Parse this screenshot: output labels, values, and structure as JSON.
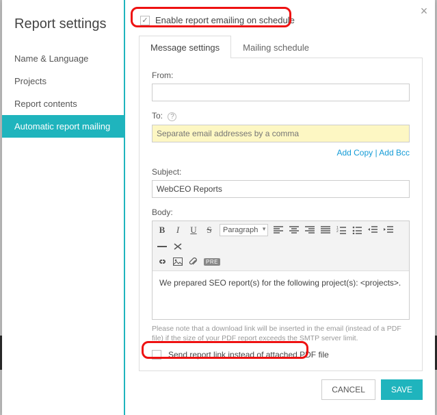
{
  "modal": {
    "title": "Report settings",
    "nav": [
      {
        "label": "Name & Language"
      },
      {
        "label": "Projects"
      },
      {
        "label": "Report contents"
      },
      {
        "label": "Automatic report mailing"
      }
    ],
    "enable": {
      "label": "Enable report emailing on schedule",
      "checked": true
    },
    "tabs": [
      {
        "label": "Message settings"
      },
      {
        "label": "Mailing schedule"
      }
    ],
    "from": {
      "label": "From:",
      "value": ""
    },
    "to": {
      "label": "To:",
      "placeholder": "Separate email addresses by a comma"
    },
    "links": {
      "add_copy": "Add Copy",
      "add_bcc": "Add Bcc"
    },
    "subject": {
      "label": "Subject:",
      "value": "WebCEO Reports"
    },
    "body": {
      "label": "Body:",
      "value": "We prepared SEO report(s) for the following project(s): <projects>.",
      "paragraph_label": "Paragraph"
    },
    "note": "Please note that a download link will be inserted in the email (instead of a PDF file) if the size of your PDF report exceeds the SMTP server limit.",
    "sendlink": {
      "label": "Send report link instead of attached PDF file",
      "checked": false
    },
    "buttons": {
      "cancel": "CANCEL",
      "save": "SAVE"
    }
  }
}
